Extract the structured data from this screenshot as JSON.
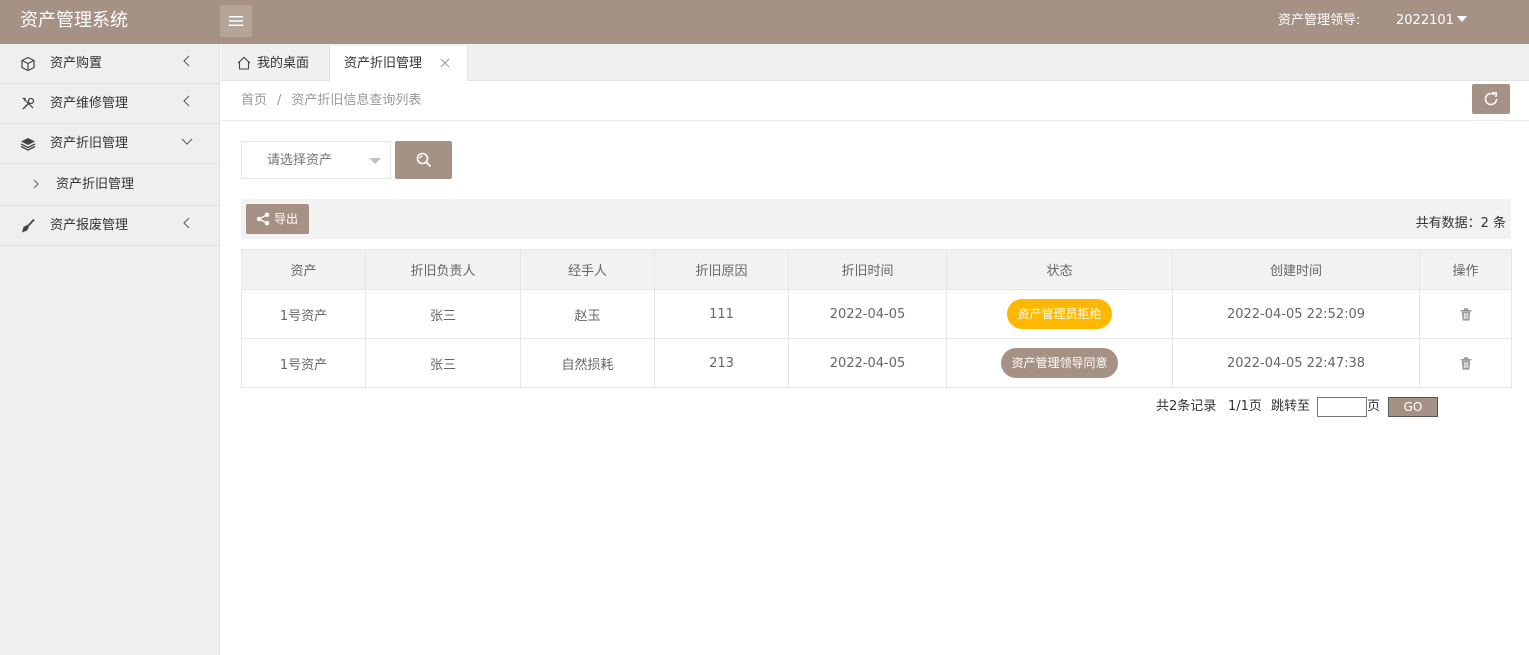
{
  "app": {
    "title": "资产管理系统"
  },
  "header": {
    "role_label": "资产管理领导:",
    "user_id": "2022101"
  },
  "sidebar": {
    "items": [
      {
        "label": "资产购置",
        "icon": "cube-icon"
      },
      {
        "label": "资产维修管理",
        "icon": "tools-icon"
      },
      {
        "label": "资产折旧管理",
        "icon": "layers-icon",
        "expanded": true
      },
      {
        "label": "资产报废管理",
        "icon": "brush-icon"
      }
    ],
    "sub_items": [
      {
        "label": "资产折旧管理"
      }
    ]
  },
  "tabs": [
    {
      "label": "我的桌面",
      "icon": "home-icon"
    },
    {
      "label": "资产折旧管理",
      "active": true
    }
  ],
  "breadcrumb": {
    "home": "首页",
    "separator": "/",
    "current": "资产折旧信息查询列表"
  },
  "search": {
    "select_placeholder": "请选择资产"
  },
  "toolbar": {
    "export_label": "导出",
    "total_text": "共有数据：2 条"
  },
  "table": {
    "columns": [
      "资产",
      "折旧负责人",
      "经手人",
      "折旧原因",
      "折旧时间",
      "状态",
      "创建时间",
      "操作"
    ],
    "rows": [
      {
        "asset": "1号资产",
        "owner": "张三",
        "handler": "赵玉",
        "reason": "111",
        "date": "2022-04-05",
        "status": "资产管理员拒绝",
        "status_color": "#ffb800",
        "created": "2022-04-05 22:52:09"
      },
      {
        "asset": "1号资产",
        "owner": "张三",
        "handler": "自然损耗",
        "reason": "213",
        "date": "2022-04-05",
        "status": "资产管理领导同意",
        "status_color": "#a59284",
        "created": "2022-04-05 22:47:38"
      }
    ]
  },
  "pager": {
    "records": "共2条记录",
    "pages": "1/1页",
    "jump_label": "跳转至",
    "page_unit": "页",
    "go_label": "GO"
  },
  "colors": {
    "brand": "#a59284",
    "warning": "#ffb800"
  }
}
